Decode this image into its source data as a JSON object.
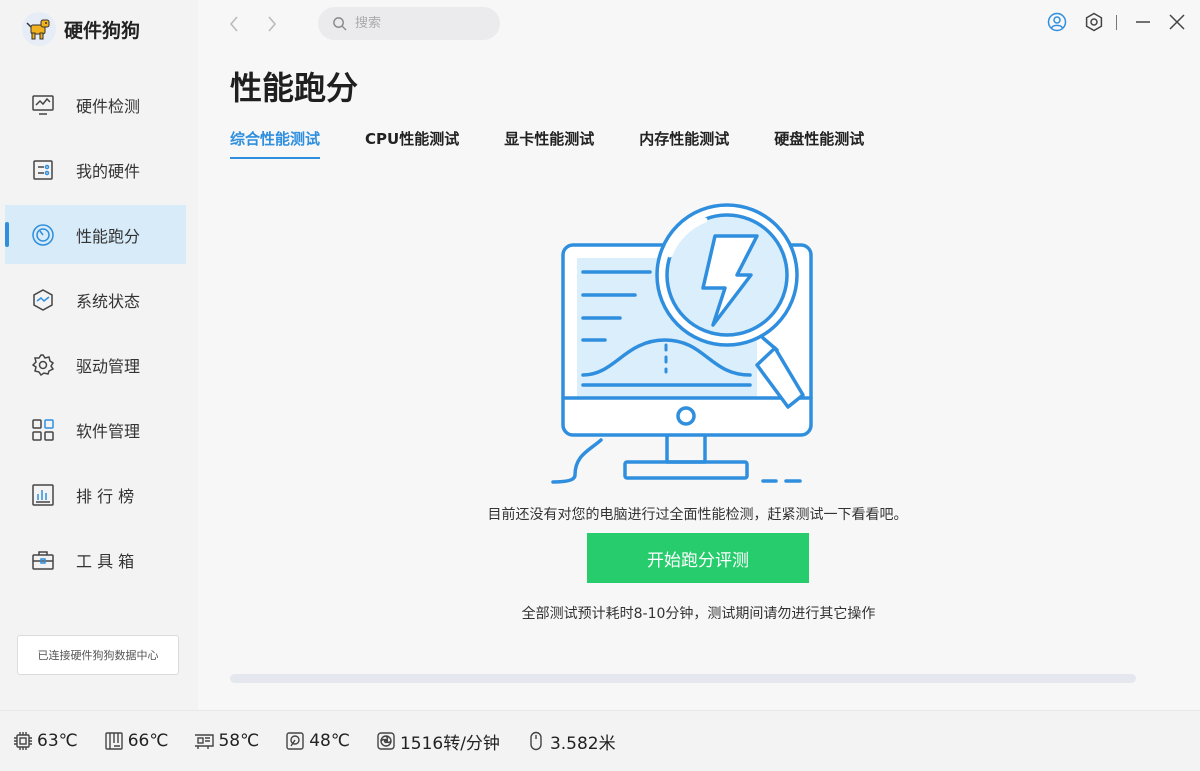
{
  "app": {
    "name": "硬件狗狗"
  },
  "search": {
    "placeholder": "搜索"
  },
  "sidebar": {
    "items": [
      {
        "label": "硬件检测",
        "icon": "monitor-wave-icon",
        "active": false
      },
      {
        "label": "我的硬件",
        "icon": "hardware-chip-icon",
        "active": false
      },
      {
        "label": "性能跑分",
        "icon": "speedometer-icon",
        "active": true
      },
      {
        "label": "系统状态",
        "icon": "system-status-icon",
        "active": false
      },
      {
        "label": "驱动管理",
        "icon": "gear-icon",
        "active": false
      },
      {
        "label": "软件管理",
        "icon": "app-grid-icon",
        "active": false
      },
      {
        "label": "排 行 榜",
        "icon": "ranking-chart-icon",
        "active": false
      },
      {
        "label": "工 具 箱",
        "icon": "toolbox-icon",
        "active": false
      }
    ],
    "connected_label": "已连接硬件狗狗数据中心"
  },
  "main": {
    "title": "性能跑分",
    "tabs": [
      {
        "label": "综合性能测试",
        "active": true
      },
      {
        "label": "CPU性能测试",
        "active": false
      },
      {
        "label": "显卡性能测试",
        "active": false
      },
      {
        "label": "内存性能测试",
        "active": false
      },
      {
        "label": "硬盘性能测试",
        "active": false
      }
    ],
    "message": "目前还没有对您的电脑进行过全面性能检测，赶紧测试一下看看吧。",
    "start_button": "开始跑分评测",
    "hint": "全部测试预计耗时8-10分钟，测试期间请勿进行其它操作",
    "progress": 0
  },
  "status": [
    {
      "icon": "cpu-icon",
      "value": "63℃"
    },
    {
      "icon": "motherboard-icon",
      "value": "66℃"
    },
    {
      "icon": "gpu-icon",
      "value": "58℃"
    },
    {
      "icon": "disk-icon",
      "value": "48℃"
    },
    {
      "icon": "fan-icon",
      "value": "1516转/分钟"
    },
    {
      "icon": "mouse-icon",
      "value": "3.582米"
    }
  ],
  "colors": {
    "accent": "#2f8fde",
    "start_button": "#27cd6d",
    "active_nav_bg": "#d7ebf9"
  }
}
